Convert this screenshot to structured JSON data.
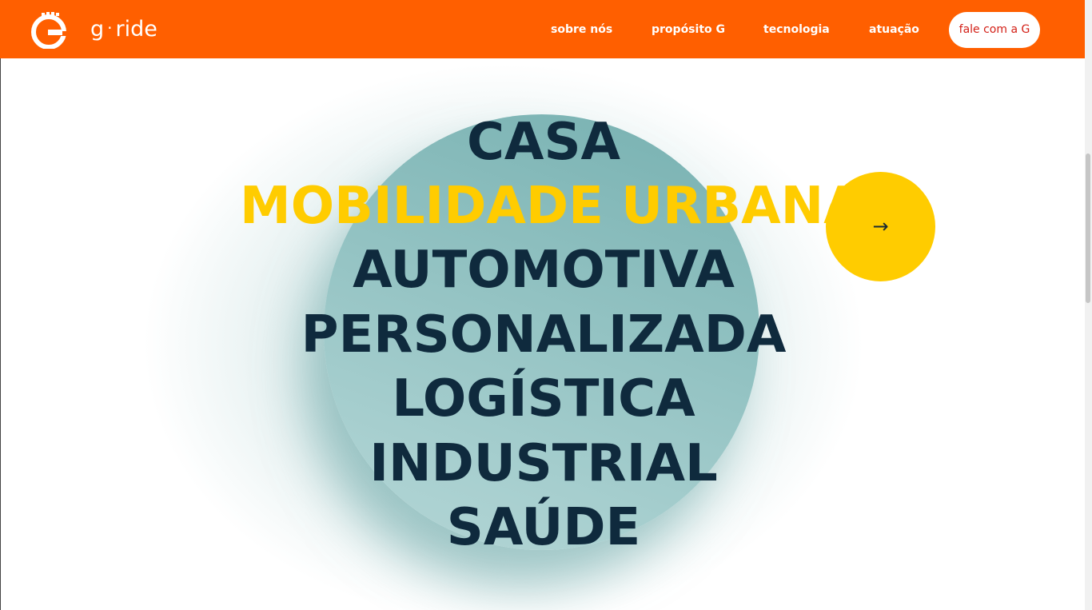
{
  "header": {
    "brand": "g · ride",
    "brand_g": "g",
    "brand_dot": "·",
    "brand_rest": "ride",
    "nav": [
      {
        "label": "sobre nós"
      },
      {
        "label": "propósito G"
      },
      {
        "label": "tecnologia"
      },
      {
        "label": "atuação"
      }
    ],
    "cta_label": "fale com a G"
  },
  "hero": {
    "words": [
      {
        "label": "CASA",
        "active": false
      },
      {
        "label": "MOBILIDADE URBANA",
        "active": true
      },
      {
        "label": "AUTOMOTIVA",
        "active": false
      },
      {
        "label": "PERSONALIZADA",
        "active": false
      },
      {
        "label": "LOGÍSTICA",
        "active": false
      },
      {
        "label": "INDUSTRIAL",
        "active": false
      },
      {
        "label": "SAÚDE",
        "active": false
      }
    ],
    "next_arrow": "→"
  },
  "colors": {
    "header_bg": "#ff5f00",
    "accent_yellow": "#ffcc00",
    "text_dark": "#0f2a3d",
    "circle_teal": "#8fc0c0",
    "cta_text": "#d31f16"
  },
  "icons": {
    "logo": "g-ride-logo-icon",
    "next": "arrow-right-icon"
  }
}
